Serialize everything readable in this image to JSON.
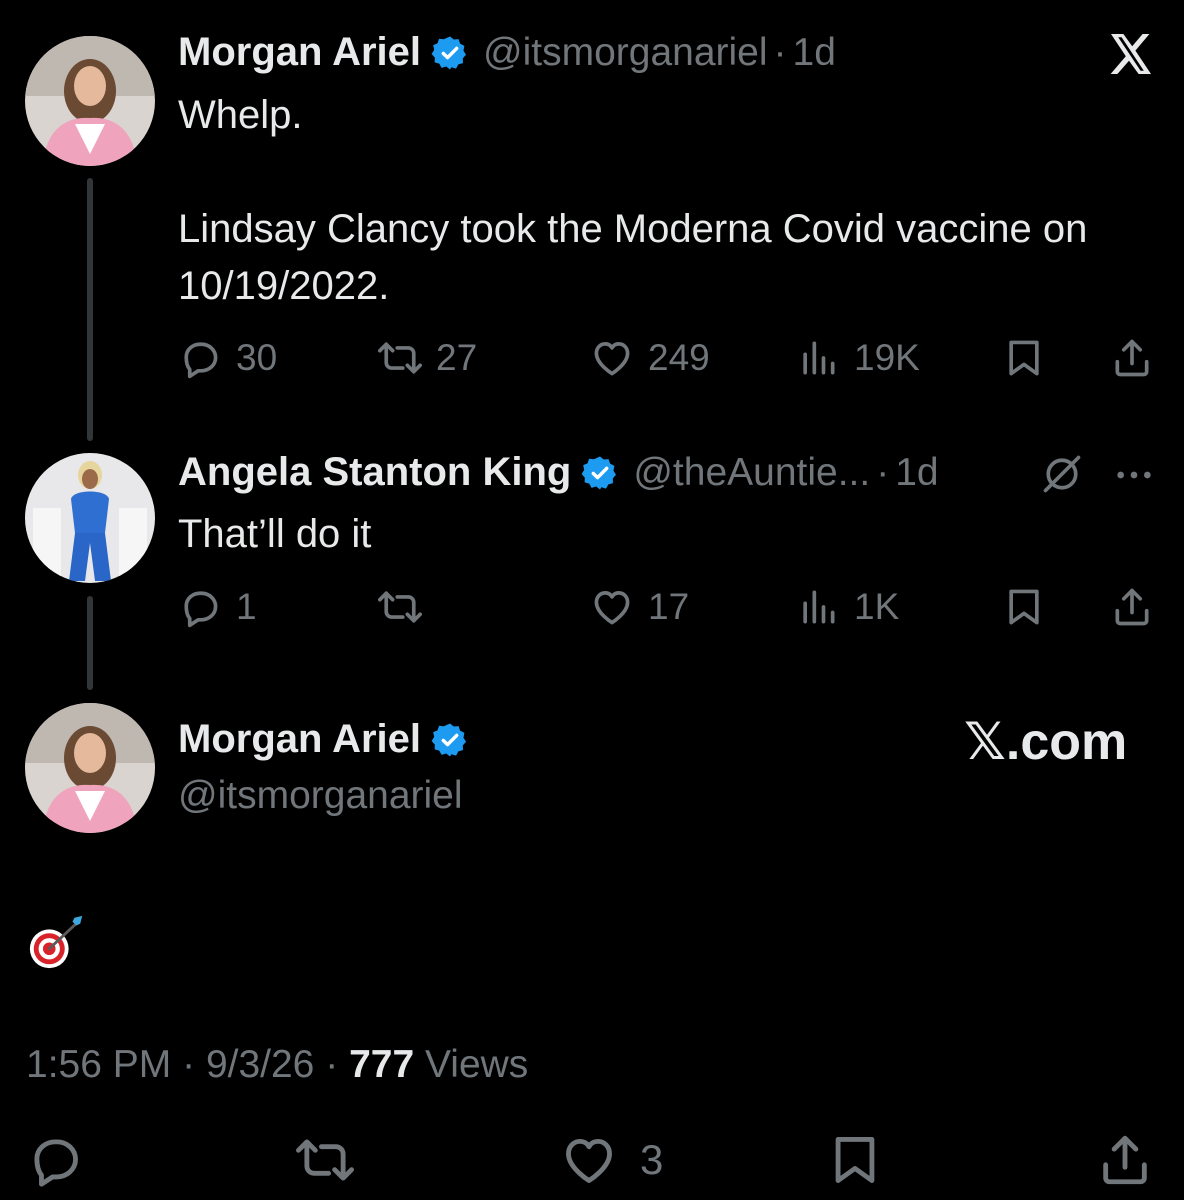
{
  "tweet1": {
    "name": "Morgan Ariel",
    "handle": "@itsmorganariel",
    "separator": "·",
    "time": "1d",
    "text": "Whelp.\n\nLindsay Clancy took the Moderna Covid vaccine on 10/19/2022.",
    "replies": "30",
    "retweets": "27",
    "likes": "249",
    "views": "19K"
  },
  "tweet2": {
    "name": "Angela Stanton King",
    "handle": "@theAuntie...",
    "separator": "·",
    "time": "1d",
    "text": "That’ll do it",
    "replies": "1",
    "retweets": "",
    "likes": "17",
    "views": "1K"
  },
  "tweet3": {
    "name": "Morgan Ariel",
    "handle": "@itsmorganariel",
    "brand": "𝕏.com",
    "emoji": "🎯"
  },
  "meta": {
    "time": "1:56 PM",
    "sep1": "·",
    "date": "9/3/26",
    "sep2": "·",
    "views_count": "777",
    "views_label": "Views"
  },
  "bottom_bar": {
    "likes": "3"
  },
  "icons": {
    "reply": "reply-icon",
    "retweet": "retweet-icon",
    "like": "heart-icon",
    "views": "views-icon",
    "bookmark": "bookmark-icon",
    "share": "share-icon",
    "verified": "verified-badge-icon",
    "x_logo": "x-logo-icon",
    "grok": "grok-icon",
    "more": "more-icon"
  },
  "colors": {
    "background": "#000000",
    "text": "#e7e9ea",
    "muted": "#71767b",
    "verified": "#1d9bf0",
    "thread_line": "#333639"
  }
}
